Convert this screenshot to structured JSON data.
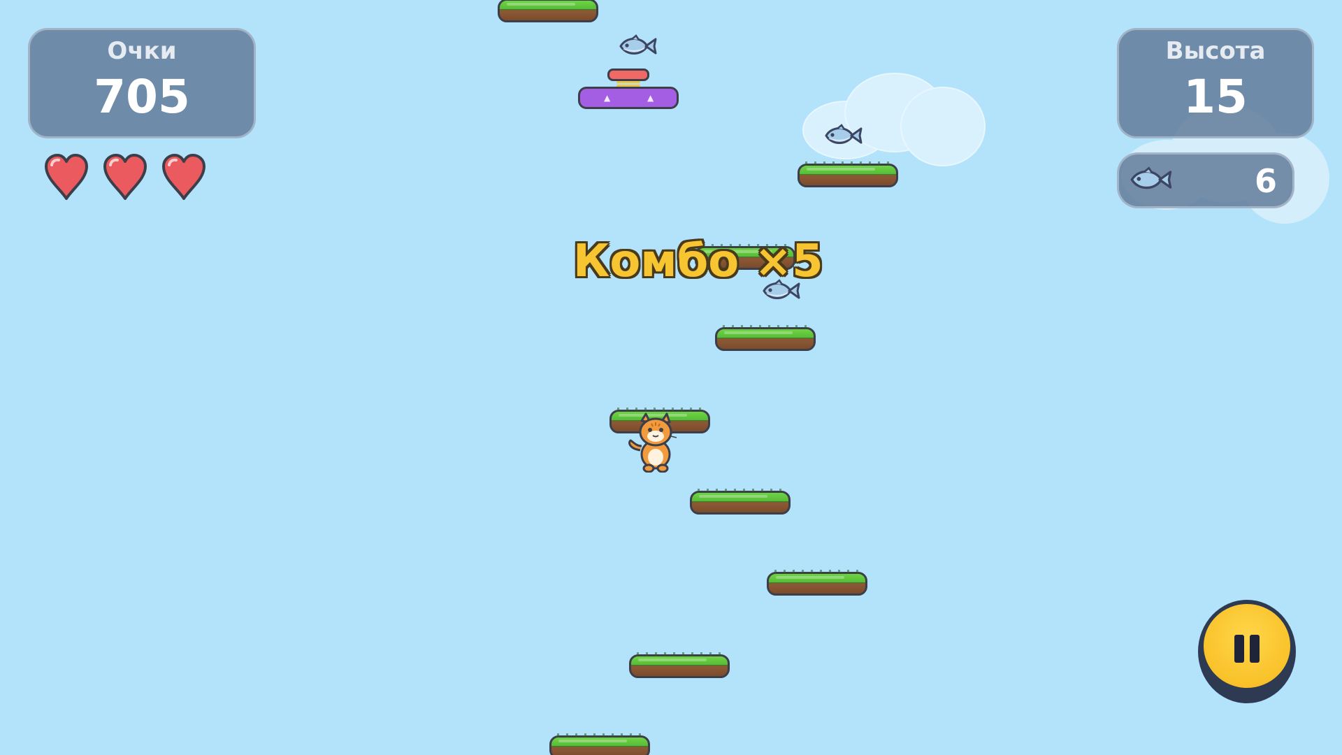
{
  "hud": {
    "score": {
      "label": "Очки",
      "value": "705"
    },
    "height": {
      "label": "Высота",
      "value": "15"
    },
    "fish_count": "6",
    "lives": 3
  },
  "combo": {
    "text": "Комбо ×5"
  },
  "icons": {
    "heart": "heart-icon",
    "fish": "fish-icon",
    "pause": "pause-icon",
    "player": "cat-character"
  },
  "colors": {
    "sky": "#b3e3fb",
    "combo_text": "#f6c531",
    "pause_button": "#f9c22a",
    "platform_grass": "#58bd38",
    "platform_dirt": "#7b4b2c",
    "spring_platform": "#a35ee4",
    "heart": "#ea5a5f"
  }
}
